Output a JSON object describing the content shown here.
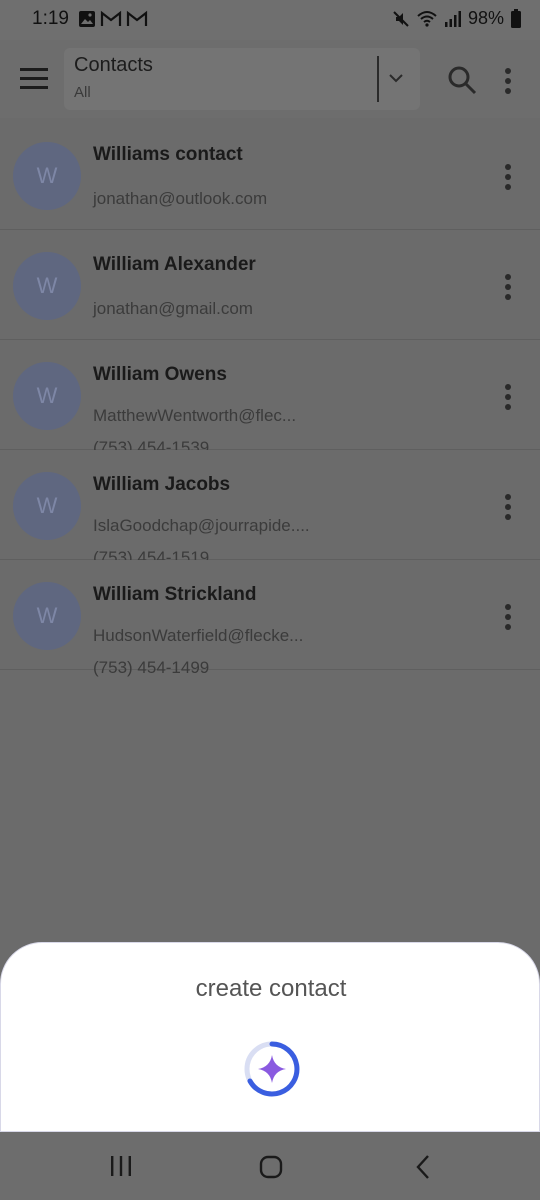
{
  "status_bar": {
    "time": "1:19",
    "battery": "98%",
    "notification_icons": [
      "gallery-icon",
      "gmail-icon",
      "gmail-icon"
    ],
    "status_icons": [
      "mute-icon",
      "wifi-icon",
      "signal-icon",
      "battery-icon"
    ]
  },
  "app_bar": {
    "title": "Contacts",
    "subtitle": "All"
  },
  "contacts": [
    {
      "initial": "W",
      "name": "Williams contact",
      "email": "jonathan@outlook.com",
      "phone": ""
    },
    {
      "initial": "W",
      "name": "William Alexander",
      "email": "jonathan@gmail.com",
      "phone": ""
    },
    {
      "initial": "W",
      "name": "William Owens",
      "email": "MatthewWentworth@flec...",
      "phone": "(753) 454-1539"
    },
    {
      "initial": "W",
      "name": "William Jacobs",
      "email": "IslaGoodchap@jourrapide....",
      "phone": "(753) 454-1519"
    },
    {
      "initial": "W",
      "name": "William Strickland",
      "email": "HudsonWaterfield@flecke...",
      "phone": "(753) 454-1499"
    }
  ],
  "sheet": {
    "title": "create contact"
  },
  "colors": {
    "accent_blue": "#3a5ee0",
    "sparkle_purple": "#8a5ae0",
    "overlay_gray": "#6b6b6b"
  }
}
